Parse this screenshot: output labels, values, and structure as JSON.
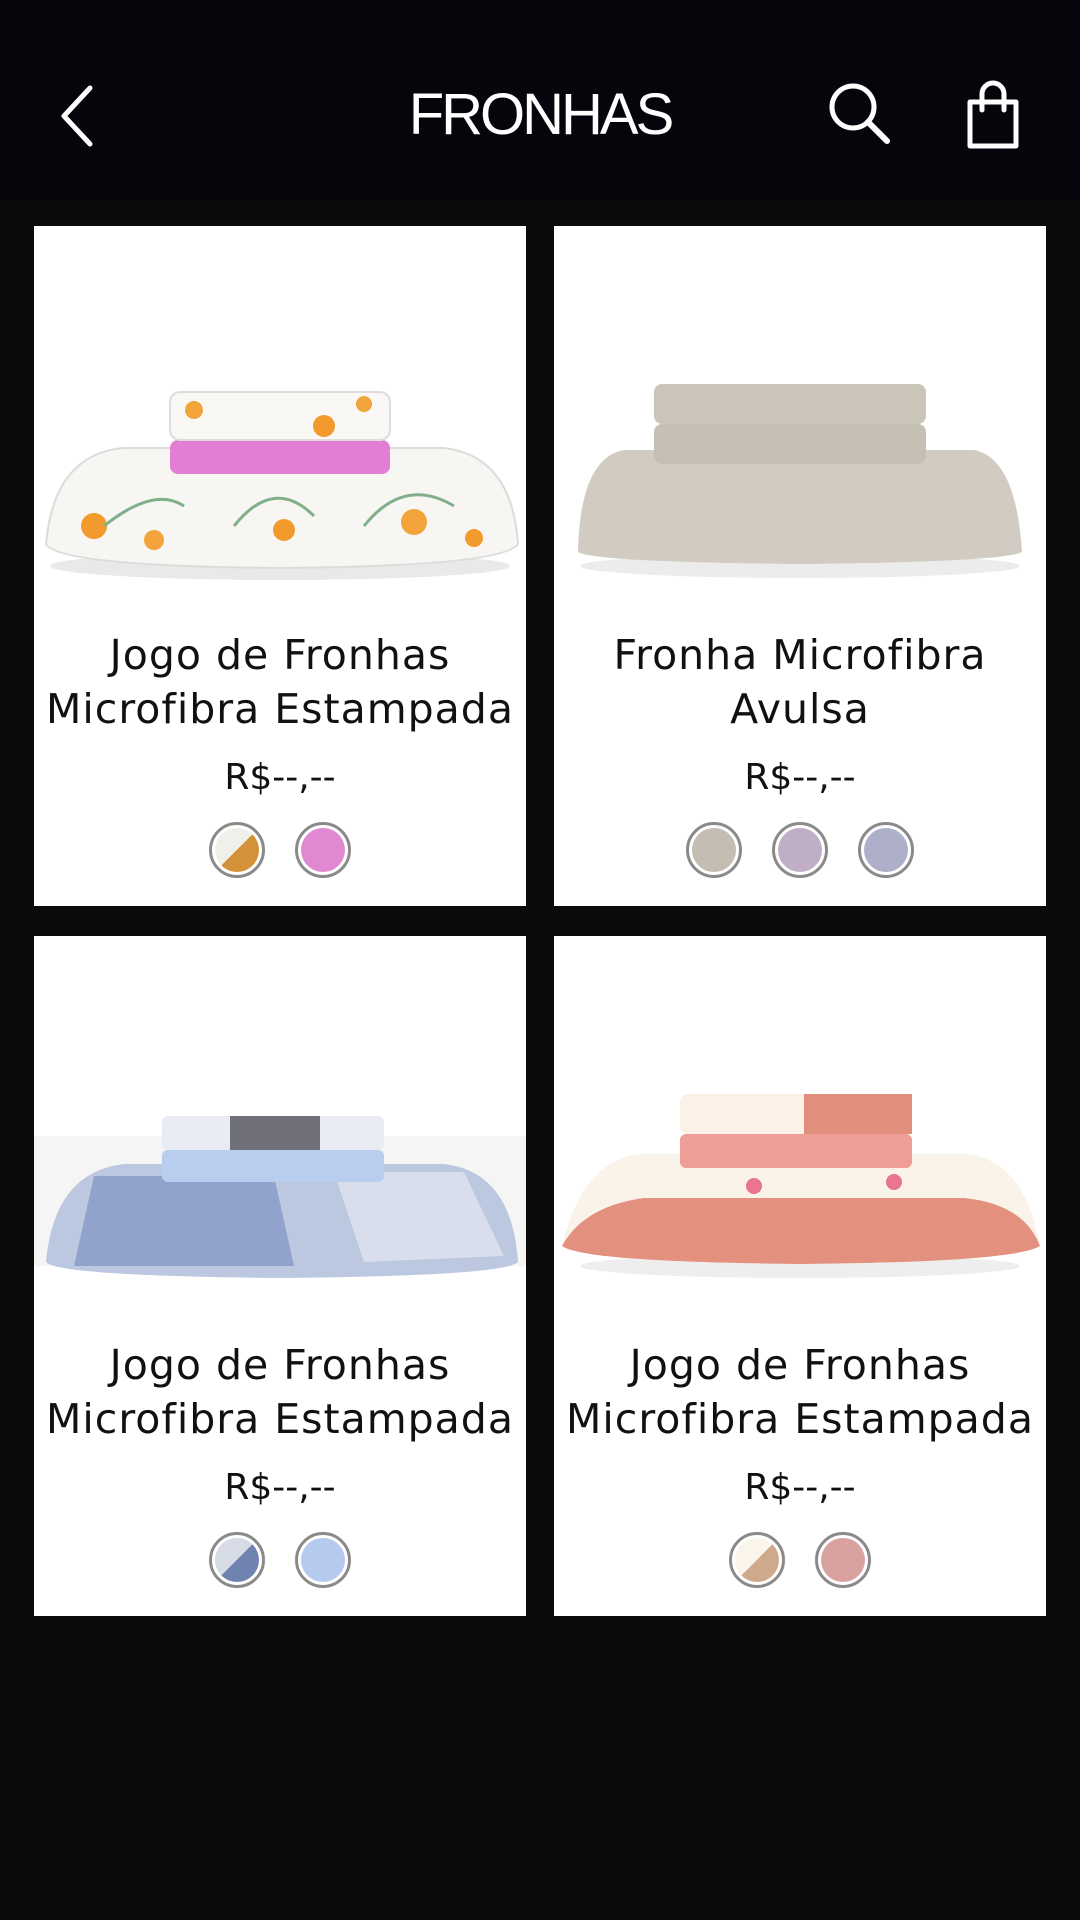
{
  "header": {
    "title": "FRONHAS",
    "back_icon": "chevron-left-icon",
    "search_icon": "search-icon",
    "bag_icon": "shopping-bag-icon"
  },
  "colors": {
    "header_bg": "#05060c",
    "page_bg": "#0c0a09",
    "card_bg": "#ffffff"
  },
  "products": [
    {
      "name": "Jogo de Fronhas Microfibra Estampada",
      "price": "R$--,--",
      "swatch_colors": [
        "split:#f0efe9:#d3923a",
        "#e089d2"
      ]
    },
    {
      "name": "Fronha Microfibra Avulsa",
      "price": "R$--,--",
      "swatch_colors": [
        "#c4bdb1",
        "#c0aec6",
        "#aeb0c9"
      ]
    },
    {
      "name": "Jogo de Fronhas Microfibra Estampada",
      "price": "R$--,--",
      "swatch_colors": [
        "split:#d6dbe6:#6f82b0",
        "#b5caee"
      ]
    },
    {
      "name": "Jogo de Fronhas Microfibra Estampada",
      "price": "R$--,--",
      "swatch_colors": [
        "split:#fbf4ea:#cfa98c",
        "#d9a29e"
      ]
    }
  ]
}
